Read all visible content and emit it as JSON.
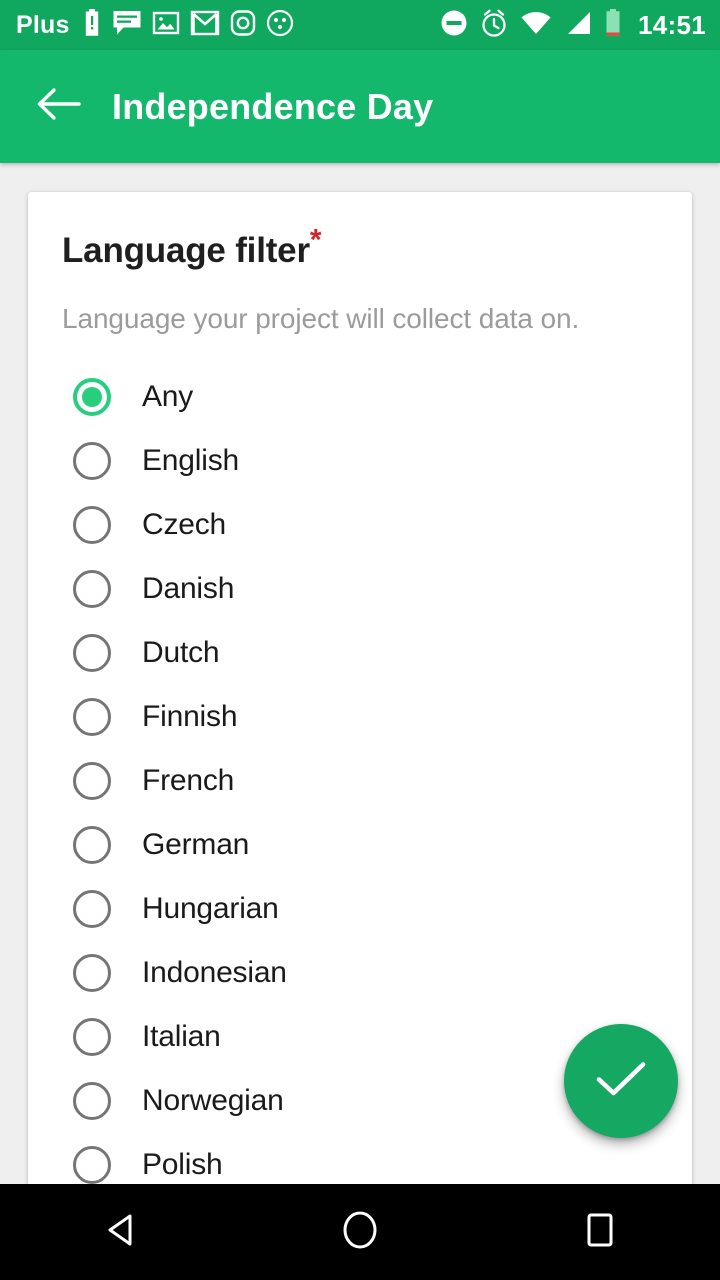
{
  "status_bar": {
    "carrier": "Plus",
    "clock": "14:51",
    "background": "#0FA85E",
    "left_icons": [
      "battery-alert-icon",
      "message-icon",
      "photo-icon",
      "gmail-icon",
      "instagram-icon",
      "circle-dots-icon"
    ],
    "right_icons": [
      "do-not-disturb-icon",
      "alarm-icon",
      "wifi-icon",
      "signal-icon",
      "battery-icon"
    ]
  },
  "app_bar": {
    "title": "Independence Day",
    "back_icon": "arrow-back-icon",
    "background": "#13B86C"
  },
  "card": {
    "title": "Language filter",
    "required_mark": "*",
    "required_color": "#D3242C",
    "subtitle": "Language your project will collect data on."
  },
  "language_options": [
    {
      "label": "Any",
      "selected": true
    },
    {
      "label": "English",
      "selected": false
    },
    {
      "label": "Czech",
      "selected": false
    },
    {
      "label": "Danish",
      "selected": false
    },
    {
      "label": "Dutch",
      "selected": false
    },
    {
      "label": "Finnish",
      "selected": false
    },
    {
      "label": "French",
      "selected": false
    },
    {
      "label": "German",
      "selected": false
    },
    {
      "label": "Hungarian",
      "selected": false
    },
    {
      "label": "Indonesian",
      "selected": false
    },
    {
      "label": "Italian",
      "selected": false
    },
    {
      "label": "Norwegian",
      "selected": false
    },
    {
      "label": "Polish",
      "selected": false
    }
  ],
  "fab": {
    "icon": "check-icon",
    "background": "#14A862"
  },
  "nav_bar": {
    "keys": [
      "back-triangle-icon",
      "home-circle-icon",
      "recents-square-icon"
    ],
    "background": "#000000"
  },
  "accent_color": "#26CE7E"
}
